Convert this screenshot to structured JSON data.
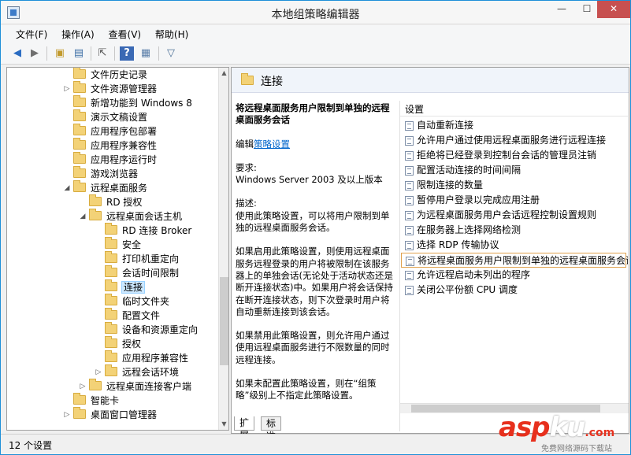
{
  "window": {
    "title": "本地组策略编辑器"
  },
  "menu": [
    "文件(F)",
    "操作(A)",
    "查看(V)",
    "帮助(H)"
  ],
  "toolbar": [
    "back-arrow-icon",
    "forward-arrow-icon",
    "up-folder-icon",
    "show-hide-tree-icon",
    "export-list-icon",
    "help-icon",
    "properties-icon",
    "filter-icon"
  ],
  "tree": [
    {
      "label": "文件历史记录",
      "level": 4,
      "exp": ""
    },
    {
      "label": "文件资源管理器",
      "level": 4,
      "exp": "▷"
    },
    {
      "label": "新增功能到 Windows 8",
      "level": 4,
      "exp": ""
    },
    {
      "label": "演示文稿设置",
      "level": 4,
      "exp": ""
    },
    {
      "label": "应用程序包部署",
      "level": 4,
      "exp": ""
    },
    {
      "label": "应用程序兼容性",
      "level": 4,
      "exp": ""
    },
    {
      "label": "应用程序运行时",
      "level": 4,
      "exp": ""
    },
    {
      "label": "游戏浏览器",
      "level": 4,
      "exp": ""
    },
    {
      "label": "远程桌面服务",
      "level": 4,
      "exp": "◢"
    },
    {
      "label": "RD 授权",
      "level": 5,
      "exp": ""
    },
    {
      "label": "远程桌面会话主机",
      "level": 5,
      "exp": "◢"
    },
    {
      "label": "RD 连接 Broker",
      "level": 6,
      "exp": ""
    },
    {
      "label": "安全",
      "level": 6,
      "exp": ""
    },
    {
      "label": "打印机重定向",
      "level": 6,
      "exp": ""
    },
    {
      "label": "会话时间限制",
      "level": 6,
      "exp": ""
    },
    {
      "label": "连接",
      "level": 6,
      "exp": "",
      "selected": true
    },
    {
      "label": "临时文件夹",
      "level": 6,
      "exp": ""
    },
    {
      "label": "配置文件",
      "level": 6,
      "exp": ""
    },
    {
      "label": "设备和资源重定向",
      "level": 6,
      "exp": ""
    },
    {
      "label": "授权",
      "level": 6,
      "exp": ""
    },
    {
      "label": "应用程序兼容性",
      "level": 6,
      "exp": ""
    },
    {
      "label": "远程会话环境",
      "level": 6,
      "exp": "▷"
    },
    {
      "label": "远程桌面连接客户端",
      "level": 5,
      "exp": "▷"
    },
    {
      "label": "智能卡",
      "level": 4,
      "exp": ""
    },
    {
      "label": "桌面窗口管理器",
      "level": 4,
      "exp": "▷"
    }
  ],
  "pane": {
    "title": "连接",
    "policy_title": "将远程桌面服务用户限制到单独的远程桌面服务会话",
    "edit_prefix": "编辑",
    "edit_link": "策略设置",
    "req_label": "要求:",
    "req_value": "Windows Server 2003 及以上版本",
    "desc_label": "描述:",
    "desc_text": "使用此策略设置，可以将用户限制到单独的远程桌面服务会话。",
    "para_enabled": "如果启用此策略设置，则使用远程桌面服务远程登录的用户将被限制在该服务器上的单独会话(无论处于活动状态还是断开连接状态)中。如果用户将会话保持在断开连接状态，则下次登录时用户将自动重新连接到该会话。",
    "para_disabled": "如果禁用此策略设置，则允许用户通过使用远程桌面服务进行不限数量的同时远程连接。",
    "para_notconfigured": "如果未配置此策略设置，则在“组策略”级别上不指定此策略设置。"
  },
  "settings_header": "设置",
  "settings": [
    {
      "label": "自动重新连接"
    },
    {
      "label": "允许用户通过使用远程桌面服务进行远程连接"
    },
    {
      "label": "拒绝将已经登录到控制台会话的管理员注销"
    },
    {
      "label": "配置活动连接的时间间隔"
    },
    {
      "label": "限制连接的数量"
    },
    {
      "label": "暂停用户登录以完成应用注册"
    },
    {
      "label": "为远程桌面服务用户会话远程控制设置规则"
    },
    {
      "label": "在服务器上选择网络检测"
    },
    {
      "label": "选择 RDP 传输协议"
    },
    {
      "label": "将远程桌面服务用户限制到单独的远程桌面服务会话",
      "selected": true
    },
    {
      "label": "允许远程启动未列出的程序"
    },
    {
      "label": "关闭公平份额 CPU 调度"
    }
  ],
  "tabs": [
    "扩展",
    "标准"
  ],
  "status": "12 个设置",
  "watermark": {
    "main_a": "asp",
    "main_b": "ku",
    "suffix": ".com",
    "sub": "免费网络源码下载站"
  }
}
